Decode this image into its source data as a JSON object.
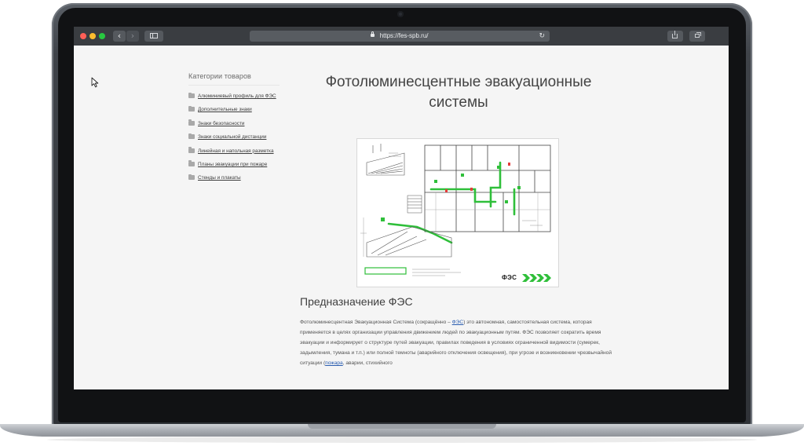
{
  "browser": {
    "url": "https://fes-spb.ru/",
    "nav_back": "‹",
    "nav_forward": "›",
    "reload": "↻"
  },
  "sidebar": {
    "title": "Категории товаров",
    "items": [
      {
        "label": "Алюминиевый профиль для ФЭС",
        "icon": "folder-icon"
      },
      {
        "label": "Дополнительные знаки",
        "icon": "folder-icon"
      },
      {
        "label": "Знаки безопасности",
        "icon": "folder-icon"
      },
      {
        "label": "Знаки социальной дистанции",
        "icon": "folder-icon"
      },
      {
        "label": "Линейная и напольная разметка",
        "icon": "folder-icon"
      },
      {
        "label": "Планы эвакуации при пожаре",
        "icon": "folder-icon"
      },
      {
        "label": "Стенды и плакаты",
        "icon": "folder-icon"
      }
    ]
  },
  "main": {
    "title_line1": "Фотолюминесцентные эвакуационные",
    "title_line2": "системы",
    "figure": {
      "logo": "ФЭС",
      "accent_color": "#2fbf3a"
    },
    "section_heading": "Предназначение ФЭС",
    "paragraph": {
      "part1": "Фотолюминесцентная Эвакуационная Система (сокращённо – ",
      "link1": "ФЭС",
      "part2": ") это автономная, самостоятельная система, которая применяется в целях организации управления движением людей по эвакуационным путям. ФЭС позволяет сократить время эвакуации и информирует о структуре путей эвакуации, правилах поведения в условиях ограниченной видимости (сумерек, задымления, тумана и т.п.) или полной темноты (аварийного отключения освещения), при угрозе и возникновении чрезвычайной ситуации (",
      "link2": "пожара",
      "part3": ", аварии, стихийного"
    }
  },
  "colors": {
    "traffic_red": "#ff5f57",
    "traffic_yellow": "#febc2e",
    "traffic_green": "#28c840",
    "link": "#2a5db0"
  }
}
